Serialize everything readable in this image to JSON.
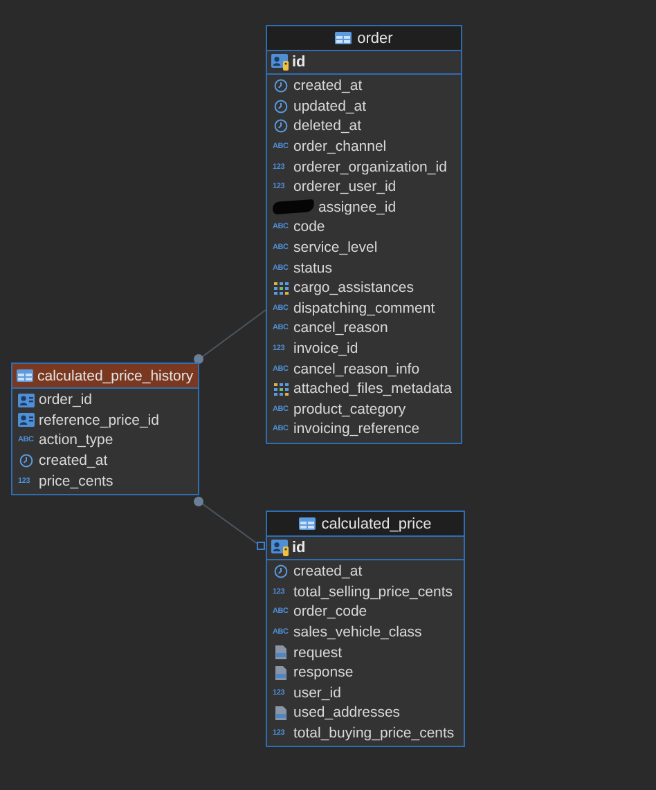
{
  "tables": [
    {
      "name": "order",
      "selected": false,
      "key": {
        "name": "id"
      },
      "columns": [
        {
          "name": "created_at",
          "kind": "time"
        },
        {
          "name": "updated_at",
          "kind": "time"
        },
        {
          "name": "deleted_at",
          "kind": "time"
        },
        {
          "name": "order_channel",
          "kind": "text",
          "badge": "ABC"
        },
        {
          "name": "orderer_organization_id",
          "kind": "number",
          "badge": "123"
        },
        {
          "name": "orderer_user_id",
          "kind": "number",
          "badge": "123"
        },
        {
          "name": "assignee_id",
          "kind": "redacted"
        },
        {
          "name": "code",
          "kind": "text",
          "badge": "ABC"
        },
        {
          "name": "service_level",
          "kind": "text",
          "badge": "ABC"
        },
        {
          "name": "status",
          "kind": "text",
          "badge": "ABC"
        },
        {
          "name": "cargo_assistances",
          "kind": "array"
        },
        {
          "name": "dispatching_comment",
          "kind": "text",
          "badge": "ABC"
        },
        {
          "name": "cancel_reason",
          "kind": "text",
          "badge": "ABC"
        },
        {
          "name": "invoice_id",
          "kind": "number",
          "badge": "123"
        },
        {
          "name": "cancel_reason_info",
          "kind": "text",
          "badge": "ABC"
        },
        {
          "name": "attached_files_metadata",
          "kind": "array"
        },
        {
          "name": "product_category",
          "kind": "text",
          "badge": "ABC"
        },
        {
          "name": "invoicing_reference",
          "kind": "text",
          "badge": "ABC"
        }
      ]
    },
    {
      "name": "calculated_price_history",
      "selected": true,
      "columns": [
        {
          "name": "order_id",
          "kind": "fk"
        },
        {
          "name": "reference_price_id",
          "kind": "fk"
        },
        {
          "name": "action_type",
          "kind": "text",
          "badge": "ABC"
        },
        {
          "name": "created_at",
          "kind": "time"
        },
        {
          "name": "price_cents",
          "kind": "number",
          "badge": "123"
        }
      ]
    },
    {
      "name": "calculated_price",
      "selected": false,
      "key": {
        "name": "id"
      },
      "columns": [
        {
          "name": "created_at",
          "kind": "time"
        },
        {
          "name": "total_selling_price_cents",
          "kind": "number",
          "badge": "123"
        },
        {
          "name": "order_code",
          "kind": "text",
          "badge": "ABC"
        },
        {
          "name": "sales_vehicle_class",
          "kind": "text",
          "badge": "ABC"
        },
        {
          "name": "request",
          "kind": "json"
        },
        {
          "name": "response",
          "kind": "json"
        },
        {
          "name": "user_id",
          "kind": "number",
          "badge": "123"
        },
        {
          "name": "used_addresses",
          "kind": "json"
        },
        {
          "name": "total_buying_price_cents",
          "kind": "number",
          "badge": "123"
        }
      ]
    }
  ]
}
